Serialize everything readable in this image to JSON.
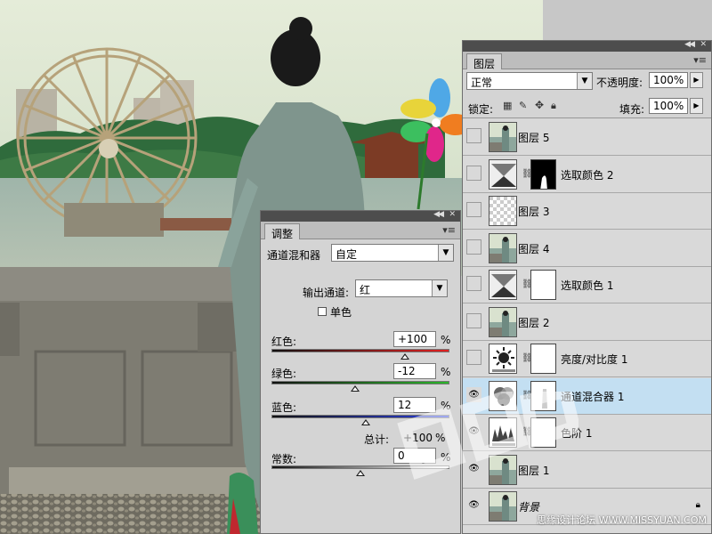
{
  "adjust_panel": {
    "tab_label": "调整",
    "mixer_label": "通道混和器",
    "preset_value": "自定",
    "output_channel_label": "输出通道:",
    "output_channel_value": "红",
    "monochrome_label": "单色",
    "monochrome_checked": false,
    "sliders": [
      {
        "label": "红色:",
        "value": "+100",
        "unit": "%",
        "percent": 100
      },
      {
        "label": "绿色:",
        "value": "-12",
        "unit": "%",
        "percent": -12
      },
      {
        "label": "蓝色:",
        "value": "12",
        "unit": "%",
        "percent": 12
      }
    ],
    "total_label": "总计:",
    "total_value": "+100",
    "total_unit": "%",
    "constant": {
      "label": "常数:",
      "value": "0",
      "unit": "%",
      "percent": 0
    }
  },
  "layers_panel": {
    "tab_label": "图层",
    "blend_mode": "正常",
    "opacity_label": "不透明度:",
    "opacity_value": "100%",
    "lock_label": "锁定:",
    "fill_label": "填充:",
    "fill_value": "100%",
    "layers": [
      {
        "name": "图层 5",
        "type": "pixel",
        "visible": false,
        "selected": false
      },
      {
        "name": "选取颜色 2",
        "type": "selective-color",
        "visible": false,
        "selected": false,
        "mask": "black-partial"
      },
      {
        "name": "图层 3",
        "type": "transparent",
        "visible": false,
        "selected": false
      },
      {
        "name": "图层 4",
        "type": "pixel",
        "visible": false,
        "selected": false
      },
      {
        "name": "选取颜色 1",
        "type": "selective-color",
        "visible": false,
        "selected": false,
        "mask": "white"
      },
      {
        "name": "图层 2",
        "type": "pixel",
        "visible": false,
        "selected": false
      },
      {
        "name": "亮度/对比度 1",
        "type": "brightness",
        "visible": false,
        "selected": false,
        "mask": "white"
      },
      {
        "name": "通道混合器 1",
        "type": "channel-mixer",
        "visible": true,
        "selected": true,
        "mask": "white-figure"
      },
      {
        "name": "色阶 1",
        "type": "levels",
        "visible": true,
        "selected": false,
        "mask": "white"
      },
      {
        "name": "图层 1",
        "type": "pixel",
        "visible": true,
        "selected": false
      },
      {
        "name": "背景",
        "type": "background",
        "visible": true,
        "selected": false,
        "locked": true
      }
    ]
  },
  "footer_credit": "思缘设计论坛 WWW.MISSYUAN.COM",
  "colors": {
    "selected_row": "#c3dff2",
    "panel_bg": "#d4d4d4",
    "panel_dark": "#4d4d4d"
  }
}
